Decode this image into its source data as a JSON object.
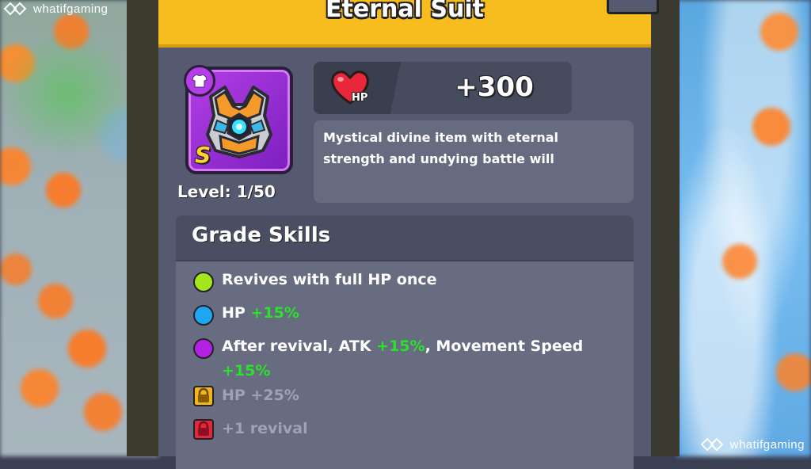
{
  "watermark": "whatifgaming",
  "item": {
    "name": "Eternal Suit",
    "grade": "S",
    "level": "Level: 1/50",
    "icons": {
      "category": "shirt-icon",
      "art": "armor-chestplate-icon"
    }
  },
  "stat": {
    "icon": "heart-hp-icon",
    "icon_label": "HP",
    "value": "+300"
  },
  "description": "Mystical divine item with eternal strength and undying battle will",
  "grade_skills": {
    "title": "Grade Skills",
    "skills": [
      {
        "parts": [
          "Revives with full HP once"
        ],
        "marker": "dot",
        "color": "#a4e61e"
      },
      {
        "parts": [
          "HP ",
          "+15%"
        ],
        "marker": "dot",
        "color": "#1fa6f2"
      },
      {
        "parts": [
          "After revival, ATK ",
          "+15%",
          ", Movement Speed",
          "+15%"
        ],
        "marker": "dot",
        "color": "#b322e0"
      },
      {
        "parts": [
          "HP +25%"
        ],
        "marker": "lock",
        "color": "#f2b51c",
        "locked": true
      },
      {
        "parts": [
          "+1 revival"
        ],
        "marker": "lock",
        "color": "#e0283e",
        "locked": true
      }
    ]
  },
  "colors": {
    "header": "#f7bd1e",
    "panel": "#555a70",
    "bonus": "#29e32a"
  }
}
